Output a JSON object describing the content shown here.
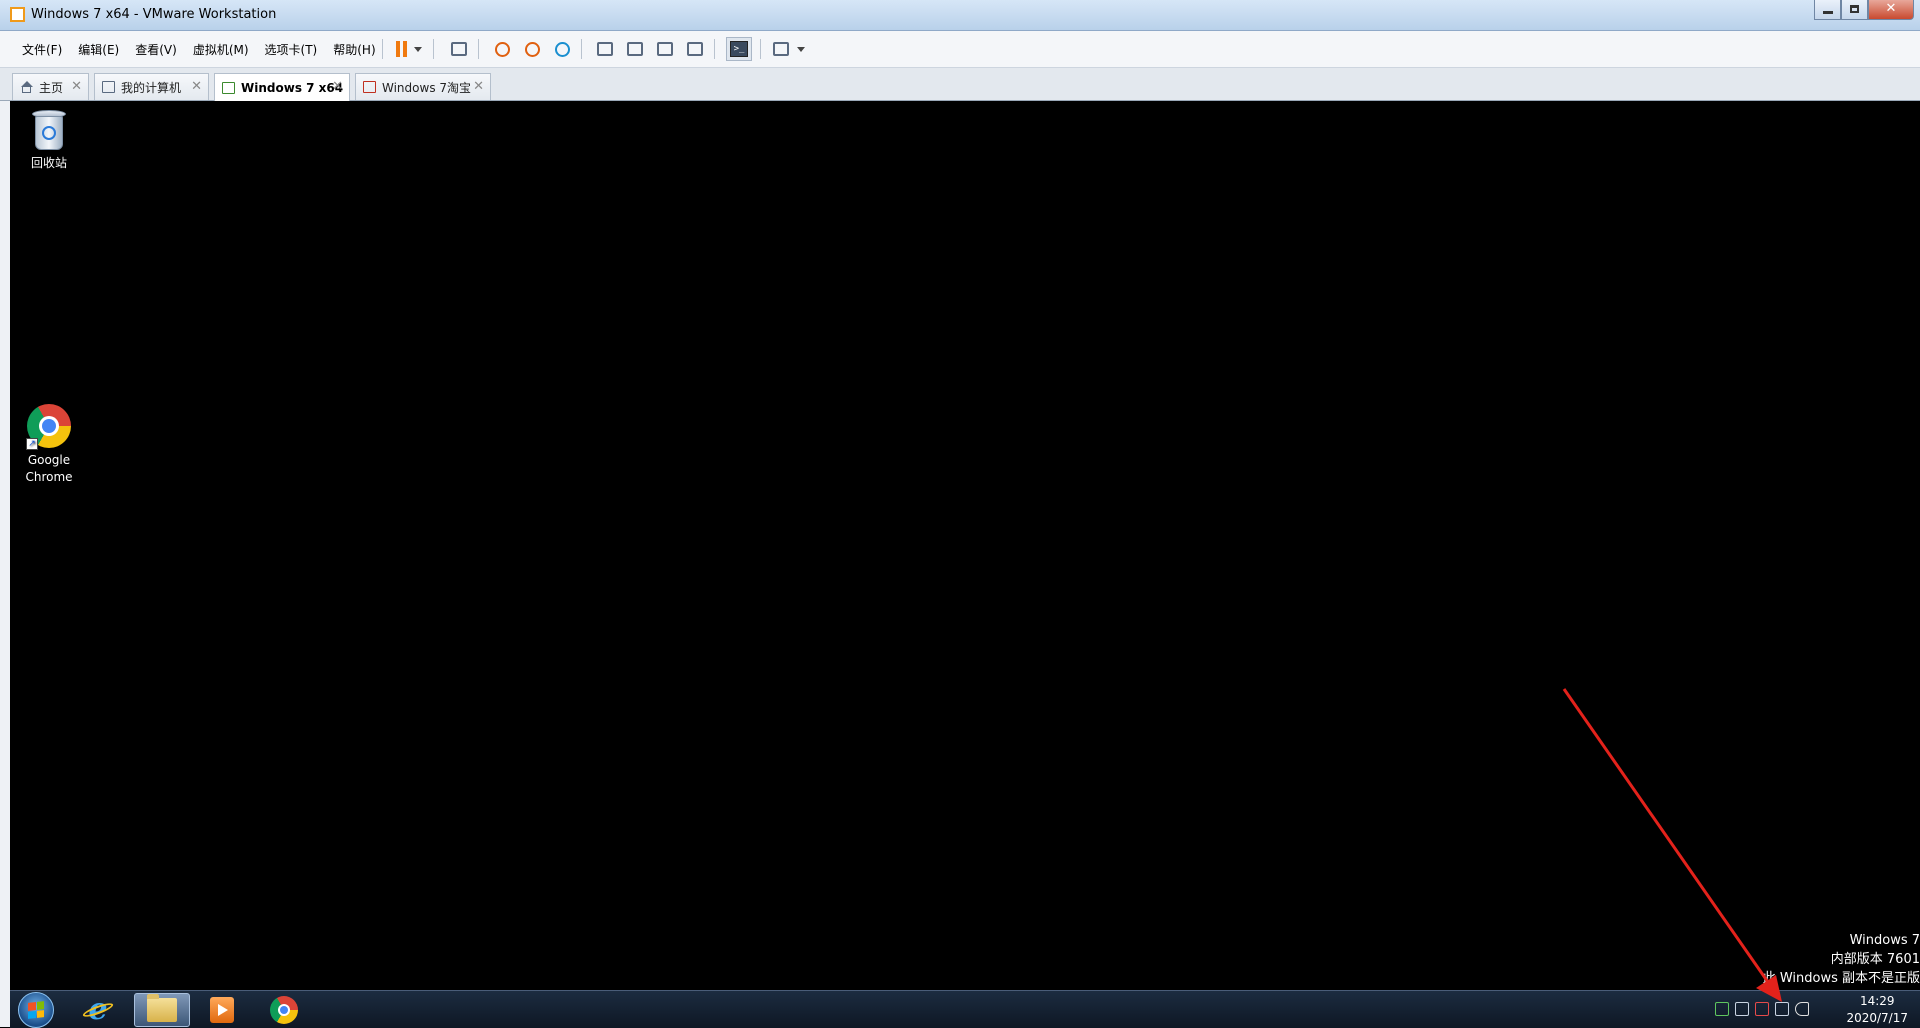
{
  "window": {
    "title": "Windows 7 x64 - VMware Workstation"
  },
  "menu": {
    "items": [
      "文件(F)",
      "编辑(E)",
      "查看(V)",
      "虚拟机(M)",
      "选项卡(T)",
      "帮助(H)"
    ]
  },
  "toolbar": {
    "icons": [
      "pause-icon",
      "dropdown-caret-icon",
      "send-keys-icon",
      "snapshot-icon",
      "revert-snapshot-icon",
      "snapshot-manager-icon",
      "library-icon",
      "thumbnail-bar-icon",
      "full-screen-icon",
      "unity-icon",
      "console-view-icon",
      "stretch-icon",
      "dropdown-caret-icon"
    ]
  },
  "tabs": [
    {
      "label": "主页",
      "icon": "home-icon",
      "active": false
    },
    {
      "label": "我的计算机",
      "icon": "computer-icon",
      "active": false
    },
    {
      "label": "Windows 7 x64",
      "icon": "vm-running-icon",
      "active": true
    },
    {
      "label": "Windows 7淘宝",
      "icon": "vm-icon",
      "active": false
    }
  ],
  "desktop": {
    "icons": [
      {
        "label": "回收站",
        "icon": "recycle-bin-icon"
      },
      {
        "label": "Google Chrome",
        "icon": "chrome-icon"
      }
    ],
    "watermark": {
      "line1": "Windows 7",
      "line2": "内部版本 7601",
      "line3": "此 Windows 副本不是正版"
    }
  },
  "taskbar": {
    "buttons": [
      "start-orb-icon",
      "internet-explorer-icon",
      "windows-explorer-icon",
      "media-player-icon",
      "chrome-icon"
    ],
    "tray_icons": [
      "network-status-icon",
      "keyboard-icon",
      "action-center-flag-icon",
      "network-connection-icon",
      "volume-muted-icon"
    ],
    "time": "14:29",
    "date": "2020/7/17"
  },
  "colors": {
    "accent_pause": "#f07a10",
    "annotation_arrow": "#e3221b"
  }
}
